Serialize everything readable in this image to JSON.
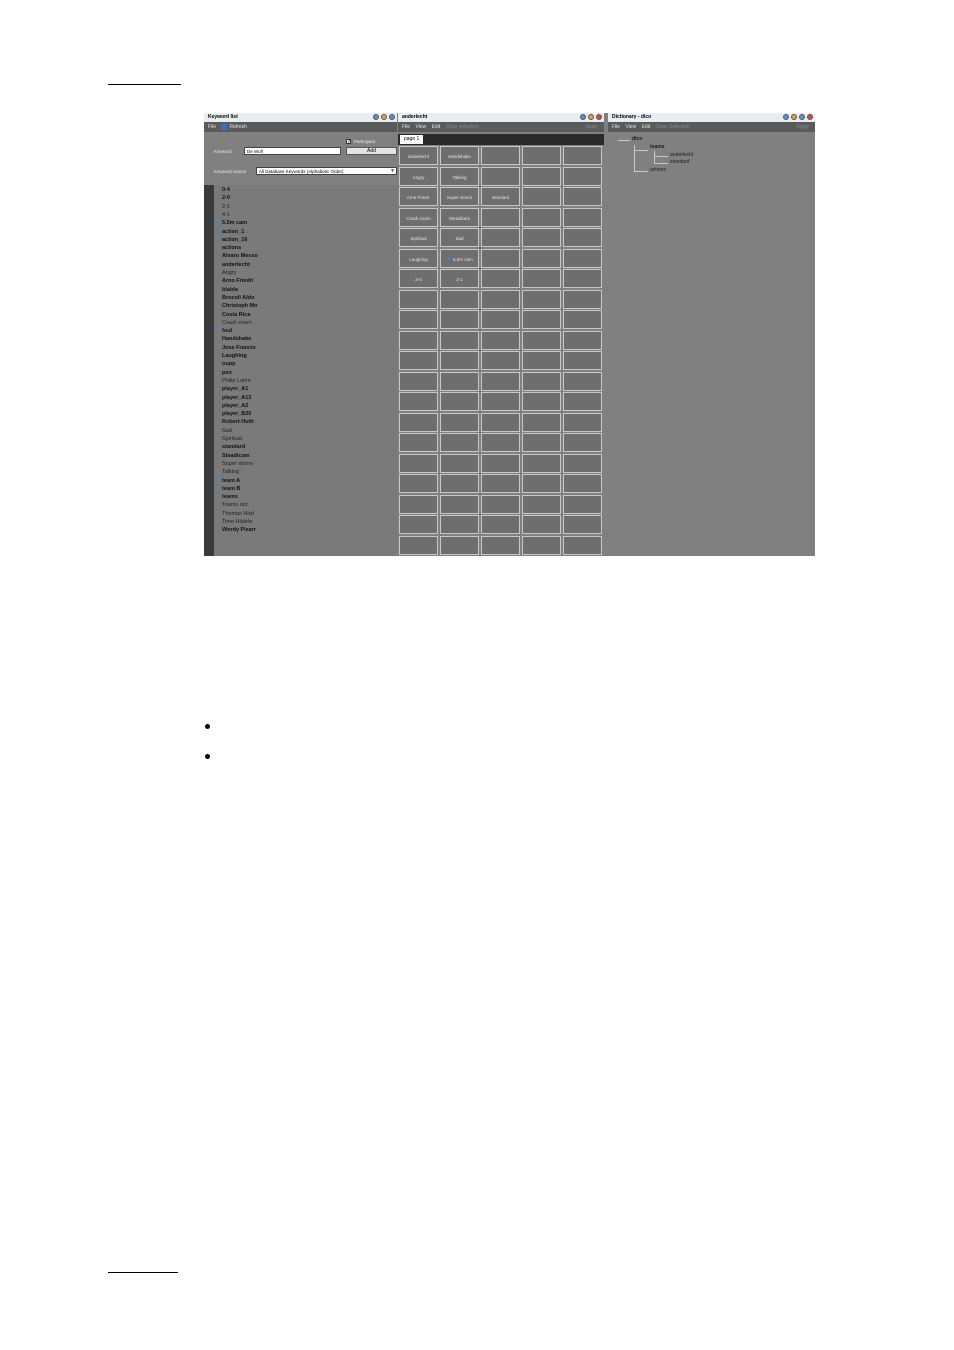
{
  "keyword_list": {
    "title": "Keyword list",
    "menu": {
      "file": "File",
      "refresh": "Refresh"
    },
    "participant_label": "Participant",
    "keyword_label": "Keyword",
    "keyword_value": "De Wolf",
    "add_label": "Add",
    "source_label": "Keyword source",
    "source_value": "All Database Keywords (Alphabetic Order)",
    "items": [
      {
        "text": "0-4",
        "star": false,
        "bold": true
      },
      {
        "text": "2-0",
        "star": false,
        "bold": true
      },
      {
        "text": "2-1",
        "star": false,
        "bold": false
      },
      {
        "text": "4-1",
        "star": false,
        "bold": false
      },
      {
        "text": "5.5m cam",
        "star": true,
        "bold": true
      },
      {
        "text": "action_1",
        "star": true,
        "bold": true
      },
      {
        "text": "action_16",
        "star": true,
        "bold": true
      },
      {
        "text": "actions",
        "star": false,
        "bold": true
      },
      {
        "text": "Alvaro Messo",
        "star": false,
        "bold": true
      },
      {
        "text": "anderlecht",
        "star": false,
        "bold": true
      },
      {
        "text": "Angry",
        "star": false,
        "bold": false
      },
      {
        "text": "Arno Friedri",
        "star": false,
        "bold": true
      },
      {
        "text": "blabla",
        "star": false,
        "bold": true
      },
      {
        "text": "Brocoli Aldo",
        "star": false,
        "bold": true
      },
      {
        "text": "Christoph Mo",
        "star": false,
        "bold": true
      },
      {
        "text": "Costa Rica",
        "star": false,
        "bold": true
      },
      {
        "text": "Crash zoom",
        "star": false,
        "bold": false
      },
      {
        "text": "foul",
        "star": true,
        "bold": true
      },
      {
        "text": "Handshake",
        "star": false,
        "bold": true
      },
      {
        "text": "Jose Francis",
        "star": false,
        "bold": true
      },
      {
        "text": "Laughing",
        "star": false,
        "bold": true
      },
      {
        "text": "oupp",
        "star": false,
        "bold": true
      },
      {
        "text": "pen",
        "star": false,
        "bold": true
      },
      {
        "text": "Philip Lahm",
        "star": false,
        "bold": false
      },
      {
        "text": "player_A1",
        "star": false,
        "bold": true
      },
      {
        "text": "player_A13",
        "star": false,
        "bold": true
      },
      {
        "text": "player_A2",
        "star": false,
        "bold": true
      },
      {
        "text": "player_B20",
        "star": false,
        "bold": true
      },
      {
        "text": "Robert Huth",
        "star": false,
        "bold": true
      },
      {
        "text": "Sad",
        "star": false,
        "bold": false
      },
      {
        "text": "Spiritual",
        "star": false,
        "bold": false
      },
      {
        "text": "standard",
        "star": false,
        "bold": true
      },
      {
        "text": "Steadicam",
        "star": false,
        "bold": true
      },
      {
        "text": "Super slomo",
        "star": false,
        "bold": false
      },
      {
        "text": "Talking",
        "star": false,
        "bold": false
      },
      {
        "text": "team A",
        "star": true,
        "bold": true
      },
      {
        "text": "team B",
        "star": true,
        "bold": true
      },
      {
        "text": "teams",
        "star": false,
        "bold": true
      },
      {
        "text": "Teams out",
        "star": false,
        "bold": false
      },
      {
        "text": "Thomas Hitzl",
        "star": false,
        "bold": false
      },
      {
        "text": "Timo Hildebr",
        "star": false,
        "bold": false
      },
      {
        "text": "Wordy Pizarr",
        "star": false,
        "bold": true
      }
    ]
  },
  "grid_window": {
    "title": "anderlecht",
    "menu": {
      "file": "File",
      "view": "View",
      "edit": "Edit",
      "clear": "Clear selection",
      "apply": "Apply"
    },
    "tab": "page 1",
    "cells": [
      [
        "anderlecht",
        "Handshake",
        "",
        "",
        ""
      ],
      [
        "Angry",
        "Talking",
        "",
        "",
        ""
      ],
      [
        "Arne Friedr.",
        "Super slomo",
        "standard",
        "",
        ""
      ],
      [
        "Crash zoom",
        "Steadicam",
        "",
        "",
        ""
      ],
      [
        "Spiritual",
        "Sad",
        "",
        "",
        ""
      ],
      [
        "Laughing",
        "5.5m cam",
        "",
        "",
        ""
      ],
      [
        "2-0",
        "2-1",
        "",
        "",
        ""
      ]
    ],
    "star_cell": "5.5m cam",
    "rows": 20,
    "cols": 5
  },
  "dictionary": {
    "title": "Dictionary - dico",
    "menu": {
      "file": "File",
      "view": "View",
      "edit": "Edit",
      "clear": "Clear Selection",
      "apply": "Apply"
    },
    "tree": {
      "root": "dico",
      "teams": "teams",
      "anderlecht": "anderlecht",
      "standard": "standard",
      "actions": "actions"
    }
  }
}
